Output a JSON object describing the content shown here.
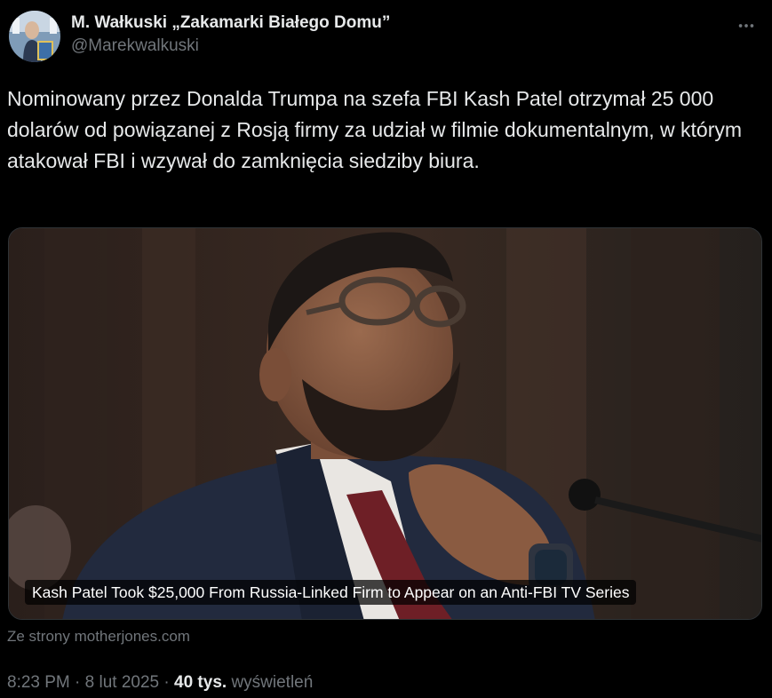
{
  "author": {
    "name": "M. Wałkuski „Zakamarki Białego Domu”",
    "handle": "@Marekwalkuski"
  },
  "tweet": {
    "text": "Nominowany przez Donalda Trumpa na szefa FBI Kash Patel otrzymał 25 000 dolarów od powiązanej z Rosją firmy za udział w filmie dokumentalnym, w którym atakował FBI i wzywał do zamknięcia siedziby biura."
  },
  "media": {
    "caption": "Kash Patel Took $25,000 From Russia-Linked Firm to Appear on an Anti-FBI TV Series",
    "source": "Ze strony motherjones.com"
  },
  "meta": {
    "time": "8:23 PM",
    "separator": "·",
    "date": "8 lut 2025",
    "views_count": "40 tys.",
    "views_label": "wyświetleń"
  },
  "icons": {
    "more": "more-horizontal-icon"
  },
  "colors": {
    "background": "#000000",
    "text_primary": "#e7e9ea",
    "text_secondary": "#71767b",
    "border": "#2f3336"
  }
}
